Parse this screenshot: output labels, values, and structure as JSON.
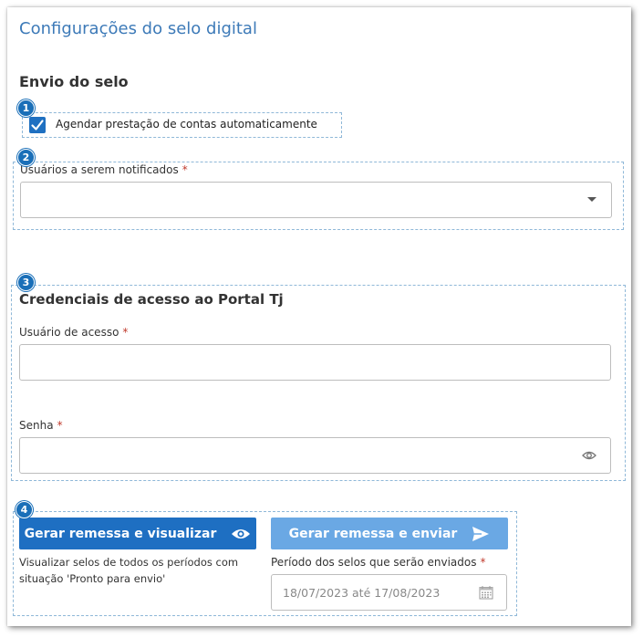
{
  "page": {
    "title": "Configurações do selo digital"
  },
  "envio": {
    "section_title": "Envio do selo",
    "checkbox_label": "Agendar prestação de contas automaticamente",
    "checkbox_checked": true,
    "usuarios_label": "Usuários a serem notificados",
    "required_mark": "*"
  },
  "credenciais": {
    "section_title": "Credenciais de acesso ao Portal Tj",
    "usuario_label": "Usuário de acesso",
    "senha_label": "Senha",
    "required_mark": "*"
  },
  "actions": {
    "visualizar_label": "Gerar remessa e visualizar",
    "visualizar_help": "Visualizar selos de todos os períodos com situação 'Pronto para envio'",
    "enviar_label": "Gerar remessa e enviar",
    "periodo_label": "Período dos selos que serão enviados",
    "periodo_value": "18/07/2023 até 17/08/2023",
    "required_mark": "*"
  },
  "badges": [
    "1",
    "2",
    "3",
    "4"
  ],
  "colors": {
    "title": "#3d7ab8",
    "primary": "#1e6fc2",
    "disabled": "#6aa8e4",
    "badge": "#1a6fb8",
    "required": "#c0392b",
    "dashed_border": "#8fb8d8"
  }
}
